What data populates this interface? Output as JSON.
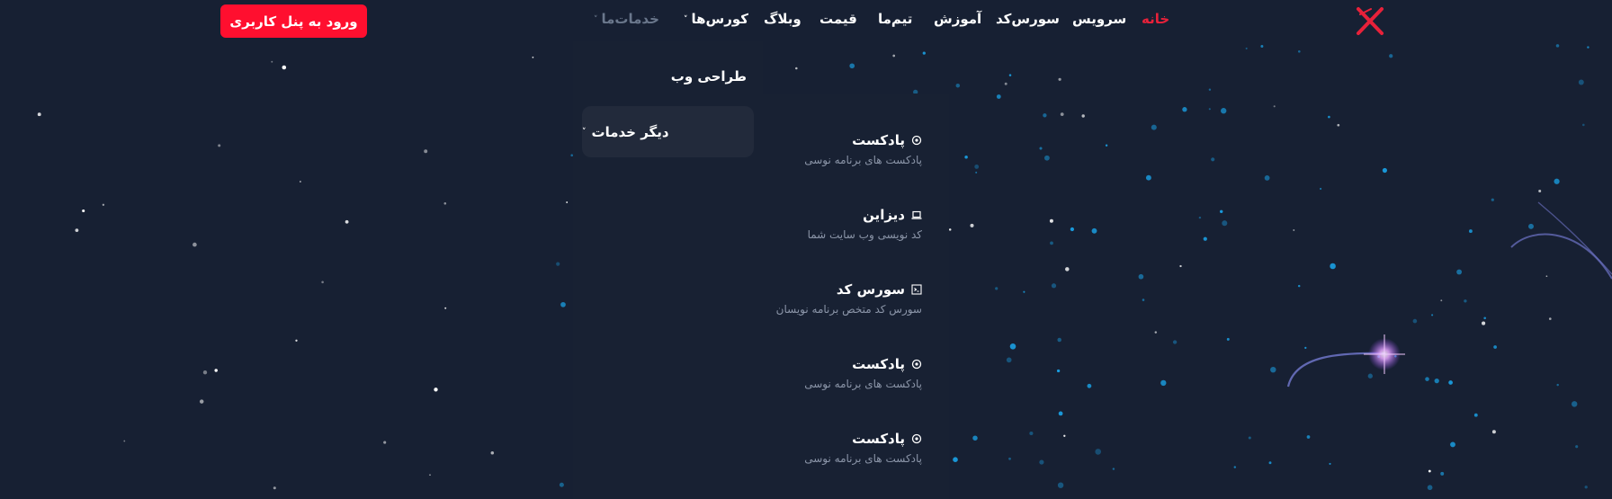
{
  "header": {
    "logo_icon": "x-logo-icon",
    "nav": {
      "home": "خانه",
      "service": "سرویس",
      "source_code": "سورس‌کد",
      "education": "آموزش",
      "team": "تیم‌ما",
      "price": "قیمت",
      "blog": "وبلاگ",
      "courses": "کورس‌ها",
      "our_services": "خدمات‌ما"
    },
    "caret": "˅",
    "login_button": "ورود به پنل کاربری",
    "active_color": "#e8213a",
    "button_color": "#ff0f2f"
  },
  "services_menu": {
    "web_design": "طراحی وب",
    "other_services": "دیگر خدمات",
    "caret": "˅"
  },
  "submenu": {
    "items": [
      {
        "title": "پادکست",
        "desc": "پادکست های برنامه نوسی",
        "icon": "podcast-icon"
      },
      {
        "title": "دیزاین",
        "desc": "کد نویسی وب سایت شما",
        "icon": "laptop-icon"
      },
      {
        "title": "سورس کد",
        "desc": "سورس کد متخص برنامه نویسان",
        "icon": "code-icon"
      },
      {
        "title": "پادکست",
        "desc": "پادکست های برنامه نوسی",
        "icon": "podcast-icon"
      },
      {
        "title": "پادکست",
        "desc": "پادکست های برنامه نوسی",
        "icon": "podcast-icon"
      }
    ]
  }
}
